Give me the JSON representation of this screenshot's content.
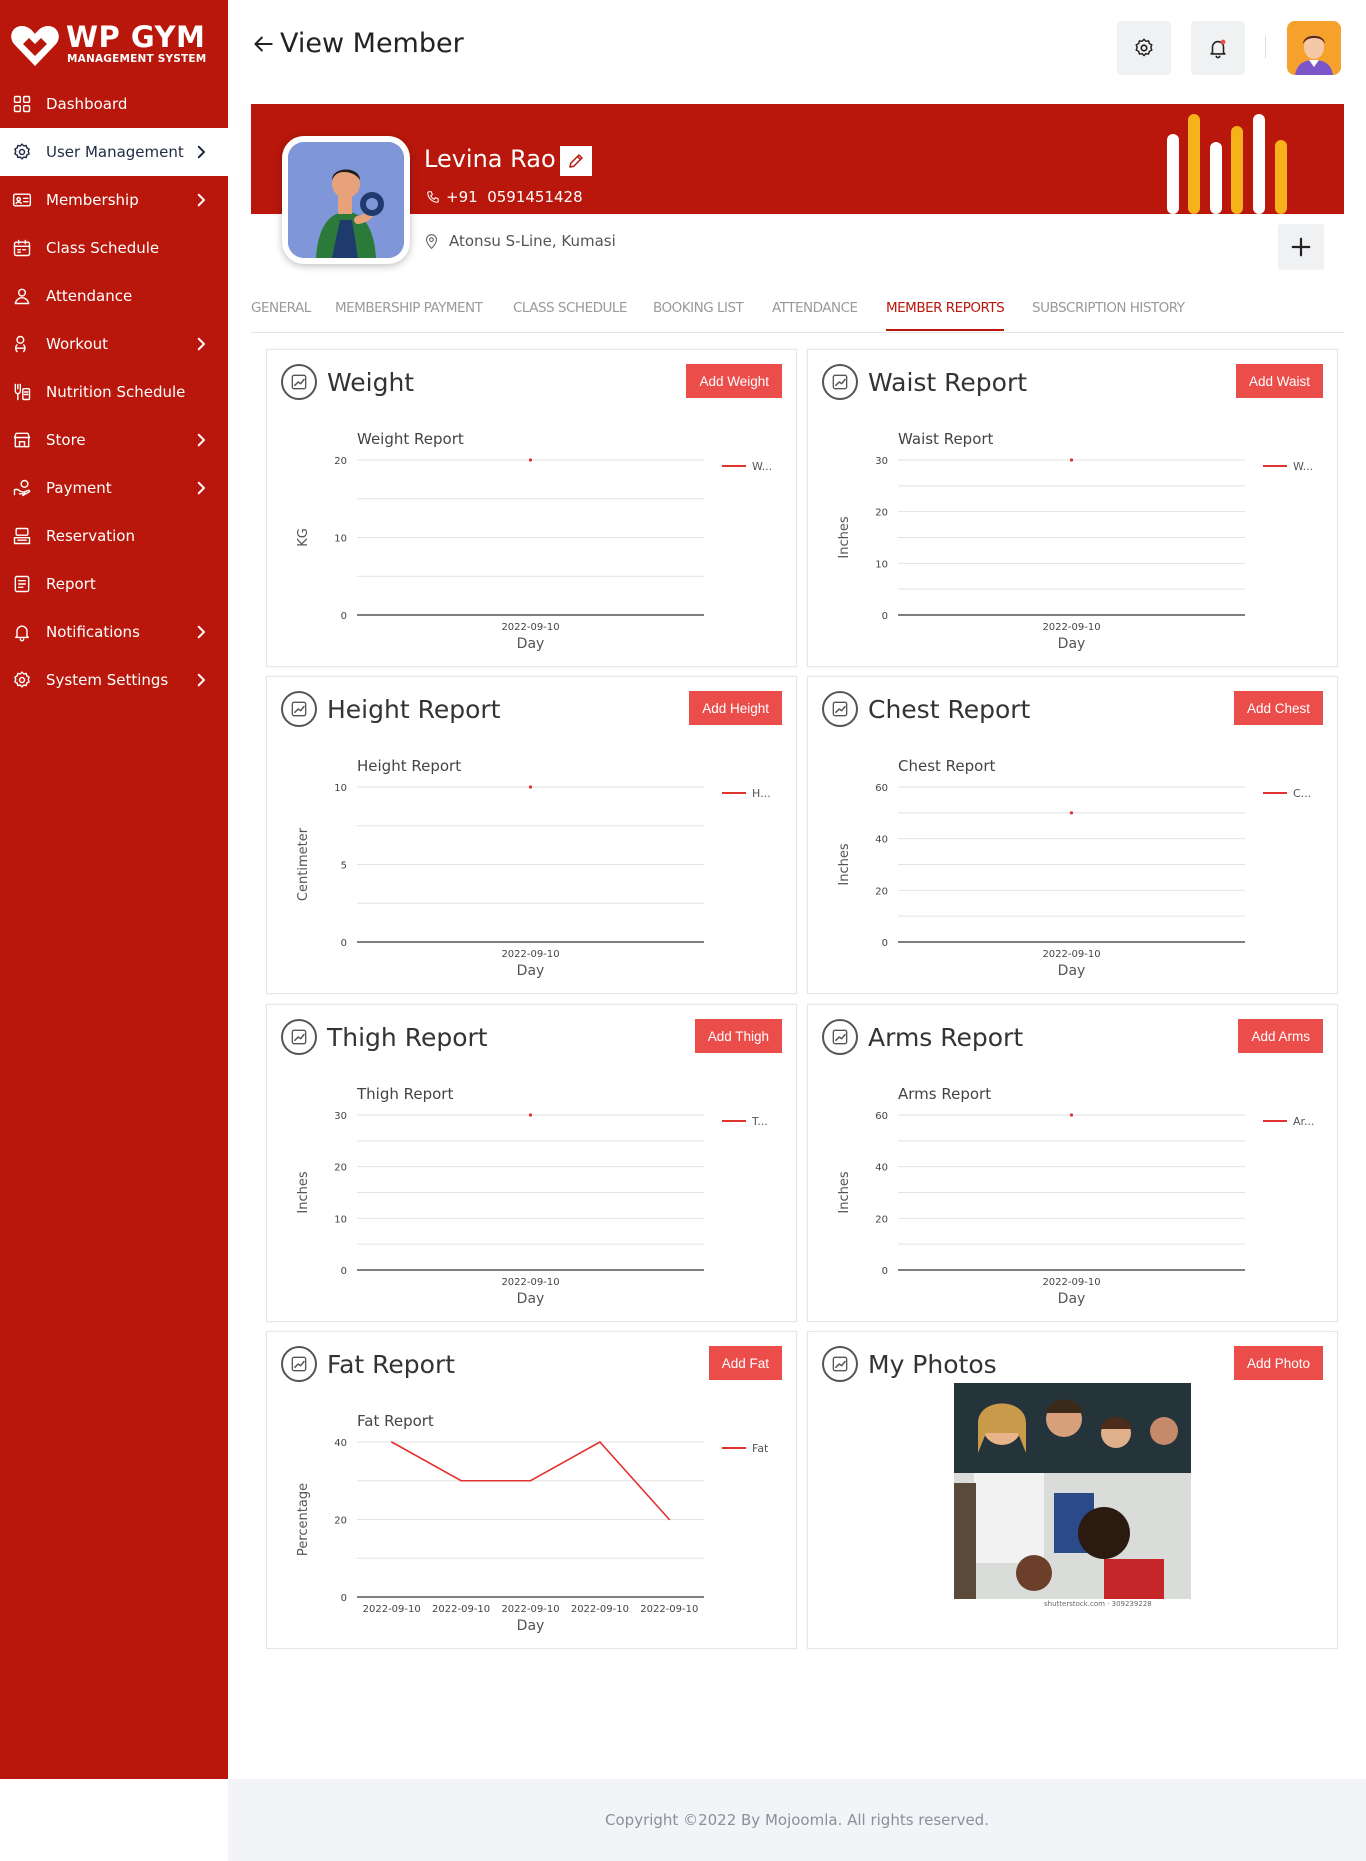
{
  "brand": {
    "name": "WP GYM",
    "subtitle": "MANAGEMENT SYSTEM"
  },
  "sidebar": {
    "items": [
      {
        "label": "Dashboard",
        "icon": "grid-icon",
        "active": false,
        "has_chevron": false
      },
      {
        "label": "User Management",
        "icon": "user-gear-icon",
        "active": true,
        "has_chevron": true
      },
      {
        "label": "Membership",
        "icon": "id-card-icon",
        "active": false,
        "has_chevron": true
      },
      {
        "label": "Class Schedule",
        "icon": "calendar-icon",
        "active": false,
        "has_chevron": false
      },
      {
        "label": "Attendance",
        "icon": "user-icon",
        "active": false,
        "has_chevron": false
      },
      {
        "label": "Workout",
        "icon": "dumbbell-icon",
        "active": false,
        "has_chevron": true
      },
      {
        "label": "Nutrition Schedule",
        "icon": "nutrition-icon",
        "active": false,
        "has_chevron": false
      },
      {
        "label": "Store",
        "icon": "store-icon",
        "active": false,
        "has_chevron": true
      },
      {
        "label": "Payment",
        "icon": "payment-icon",
        "active": false,
        "has_chevron": true
      },
      {
        "label": "Reservation",
        "icon": "reservation-icon",
        "active": false,
        "has_chevron": false
      },
      {
        "label": "Report",
        "icon": "report-icon",
        "active": false,
        "has_chevron": false
      },
      {
        "label": "Notifications",
        "icon": "bell-icon",
        "active": false,
        "has_chevron": true
      },
      {
        "label": "System Settings",
        "icon": "gear-icon",
        "active": false,
        "has_chevron": true
      }
    ]
  },
  "header": {
    "title": "View Member"
  },
  "member": {
    "name": "Levina Rao",
    "phone": "+91  0591451428",
    "address": "Atonsu S-Line, Kumasi"
  },
  "tabs": [
    {
      "label": "GENERAL",
      "active": false
    },
    {
      "label": "MEMBERSHIP PAYMENT",
      "active": false
    },
    {
      "label": "CLASS SCHEDULE",
      "active": false
    },
    {
      "label": "BOOKING LIST",
      "active": false
    },
    {
      "label": "ATTENDANCE",
      "active": false
    },
    {
      "label": "MEMBER REPORTS",
      "active": true
    },
    {
      "label": "SUBSCRIPTION HISTORY",
      "active": false
    }
  ],
  "colors": {
    "primary": "#b9170b",
    "button": "#eb4d4b",
    "line": "#e0322e",
    "bar_white": "#ffffff",
    "bar_gold": "#f6b21a"
  },
  "cards": [
    {
      "title": "Weight",
      "button": "Add Weight"
    },
    {
      "title": "Waist Report",
      "button": "Add Waist"
    },
    {
      "title": "Height Report",
      "button": "Add Height"
    },
    {
      "title": "Chest Report",
      "button": "Add Chest"
    },
    {
      "title": "Thigh Report",
      "button": "Add Thigh"
    },
    {
      "title": "Arms Report",
      "button": "Add Arms"
    },
    {
      "title": "Fat Report",
      "button": "Add Fat"
    },
    {
      "title": "My Photos",
      "button": "Add Photo"
    }
  ],
  "chart_data": [
    {
      "type": "line",
      "title": "Weight Report",
      "xlabel": "Day",
      "ylabel": "KG",
      "ylim": [
        0,
        20
      ],
      "yticks": [
        0,
        10,
        20
      ],
      "legend": "W...",
      "legend_position": "top-right",
      "grid": true,
      "x": [
        "2022-09-10"
      ],
      "series": [
        {
          "values": [
            20
          ]
        }
      ]
    },
    {
      "type": "line",
      "title": "Waist Report",
      "xlabel": "Day",
      "ylabel": "Inches",
      "ylim": [
        0,
        30
      ],
      "yticks": [
        0,
        10,
        20,
        30
      ],
      "legend": "W...",
      "legend_position": "top-right",
      "grid": true,
      "x": [
        "2022-09-10"
      ],
      "series": [
        {
          "values": [
            30
          ]
        }
      ]
    },
    {
      "type": "line",
      "title": "Height Report",
      "xlabel": "Day",
      "ylabel": "Centimeter",
      "ylim": [
        0,
        10
      ],
      "yticks": [
        0,
        5,
        10
      ],
      "legend": "H...",
      "legend_position": "top-right",
      "grid": true,
      "x": [
        "2022-09-10"
      ],
      "series": [
        {
          "values": [
            10
          ]
        }
      ]
    },
    {
      "type": "line",
      "title": "Chest Report",
      "xlabel": "Day",
      "ylabel": "Inches",
      "ylim": [
        0,
        60
      ],
      "yticks": [
        0,
        20,
        40,
        60
      ],
      "legend": "C...",
      "legend_position": "top-right",
      "grid": true,
      "x": [
        "2022-09-10"
      ],
      "series": [
        {
          "values": [
            50
          ]
        }
      ]
    },
    {
      "type": "line",
      "title": "Thigh Report",
      "xlabel": "Day",
      "ylabel": "Inches",
      "ylim": [
        0,
        30
      ],
      "yticks": [
        0,
        10,
        20,
        30
      ],
      "legend": "T...",
      "legend_position": "top-right",
      "grid": true,
      "x": [
        "2022-09-10"
      ],
      "series": [
        {
          "values": [
            30
          ]
        }
      ]
    },
    {
      "type": "line",
      "title": "Arms Report",
      "xlabel": "Day",
      "ylabel": "Inches",
      "ylim": [
        0,
        60
      ],
      "yticks": [
        0,
        20,
        40,
        60
      ],
      "legend": "Ar...",
      "legend_position": "top-right",
      "grid": true,
      "x": [
        "2022-09-10"
      ],
      "series": [
        {
          "values": [
            60
          ]
        }
      ]
    },
    {
      "type": "line",
      "title": "Fat Report",
      "xlabel": "Day",
      "ylabel": "Percentage",
      "ylim": [
        0,
        40
      ],
      "yticks": [
        0,
        20,
        40
      ],
      "legend": "Fat",
      "legend_position": "top-right",
      "grid": true,
      "x": [
        "2022-09-10",
        "2022-09-10",
        "2022-09-10",
        "2022-09-10",
        "2022-09-10"
      ],
      "series": [
        {
          "values": [
            40,
            30,
            30,
            40,
            20
          ]
        }
      ]
    }
  ],
  "photo": {
    "caption": "shutterstock.com · 309239228"
  },
  "footer": {
    "text": "Copyright ©2022 By Mojoomla. All rights reserved."
  }
}
